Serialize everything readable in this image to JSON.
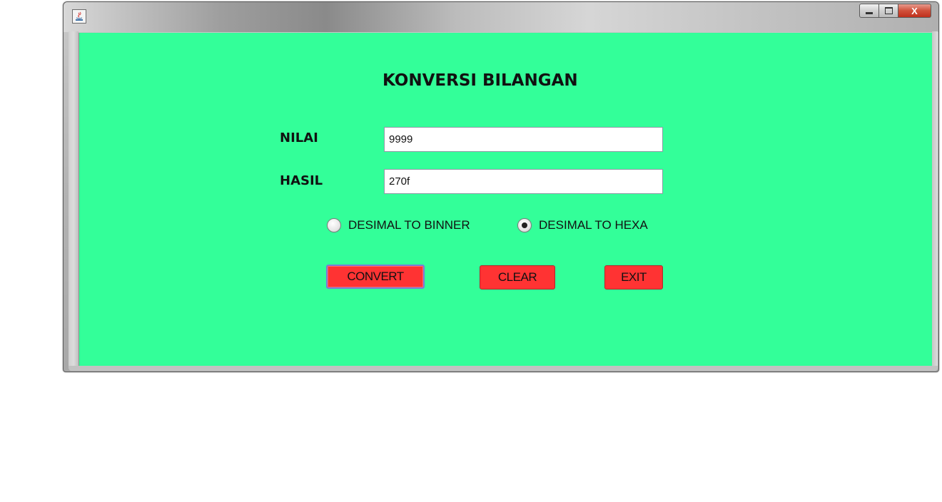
{
  "window": {
    "controls": {
      "close_glyph": "X"
    },
    "icon": "java-app-icon"
  },
  "form": {
    "title": "KONVERSI BILANGAN",
    "nilai_label": "NILAI",
    "nilai_value": "9999",
    "hasil_label": "HASIL",
    "hasil_value": "270f",
    "radios": {
      "to_binary_label": "DESIMAL TO BINNER",
      "to_binary_checked": false,
      "to_hex_label": "DESIMAL TO HEXA",
      "to_hex_checked": true
    },
    "buttons": {
      "convert": "CONVERT",
      "clear": "CLEAR",
      "exit": "EXIT"
    }
  },
  "colors": {
    "panel_background": "#33ff99",
    "button_background": "#ff3333",
    "close_button": "#c83c28"
  }
}
